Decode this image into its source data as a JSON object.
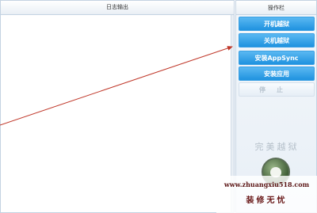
{
  "log_panel": {
    "title": "日志输出"
  },
  "op_panel": {
    "title": "操作栏",
    "buttons": {
      "boot_jailbreak": "开机越狱",
      "shutdown_jailbreak": "关机越狱",
      "install_appsync": "安装AppSync",
      "install_app": "安装应用",
      "stop": "停止"
    },
    "brand_text": "完美越狱"
  },
  "watermark": {
    "url": "www.zhuangxiu518.com",
    "title": "装修无忧"
  },
  "colors": {
    "button_blue": "#1f92df",
    "arrow_red": "#c0392b",
    "panel_border": "#c4d3e2"
  },
  "icons": {
    "logo": "apple-logo-icon"
  }
}
